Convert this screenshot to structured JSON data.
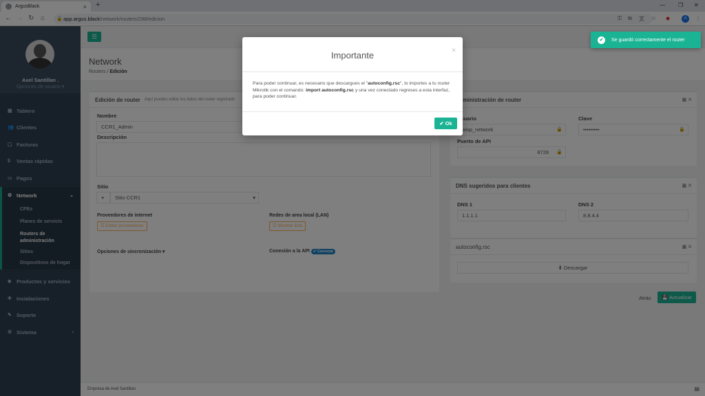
{
  "browser": {
    "tab_title": "ArgusBlack",
    "tab_close": "×",
    "new_tab": "+",
    "url_host": "app.argus.black",
    "url_path": "/network/routers/298/edicion",
    "profile_initial": "A"
  },
  "sidebar": {
    "user_name": "Axel Santillan .",
    "user_options": "Opciones de usuario ▾",
    "items": [
      {
        "label": "Tablero",
        "icon": "dashboard-icon"
      },
      {
        "label": "Clientes",
        "icon": "users-icon"
      },
      {
        "label": "Facturas",
        "icon": "file-icon"
      },
      {
        "label": "Ventas rápidas",
        "icon": "dollar-icon"
      },
      {
        "label": "Pagos",
        "icon": "money-icon"
      },
      {
        "label": "Network",
        "icon": "gear-icon"
      },
      {
        "label": "Productos y servicios",
        "icon": "tag-icon"
      },
      {
        "label": "Instalaciones",
        "icon": "wrench-icon"
      },
      {
        "label": "Soporte",
        "icon": "support-icon"
      },
      {
        "label": "Sistema",
        "icon": "cogs-icon"
      }
    ],
    "network_sub": [
      "CPEs",
      "Planes de servicio",
      "Routers de",
      "administración",
      "Sitios",
      "Dispositivos de hogar"
    ]
  },
  "page": {
    "title": "Network",
    "crumb_root": "Routers",
    "crumb_sep": "/",
    "crumb_current": "Edición"
  },
  "edit_panel": {
    "title": "Edición de router",
    "subtitle": "Aquí puedes editar los datos del router registrado",
    "name_label": "Nombre",
    "name_value": "CCR1_Admin",
    "desc_label": "Descripción",
    "site_label": "Sitio",
    "site_add": "+",
    "site_value": "Sitio CCR1",
    "isp_label": "Proveedores de internet",
    "isp_button": "☰ Editar proveedores",
    "lan_label": "Redes de area local (LAN)",
    "lan_button": "☰ Mostrar lista",
    "sync_label": "Opciones de sincronización ▾",
    "api_label": "Conexión a la API",
    "api_badge": "✔ Correcta"
  },
  "admin_panel": {
    "title": "Administración de router",
    "user_label": "Usuario",
    "user_value": "wisp_network",
    "key_label": "Clave",
    "key_value": "•••••••••",
    "port_label": "Puerto de API",
    "port_value": "8728"
  },
  "dns_panel": {
    "title": "DNS sugeridos para clientes",
    "dns1_label": "DNS 1",
    "dns1_value": "1.1.1.1",
    "dns2_label": "DNS 2",
    "dns2_value": "8.8.4.4"
  },
  "autoconf_panel": {
    "title": "autoconfig.rsc",
    "download": "⬇ Descargar"
  },
  "actions": {
    "back": "Atrás",
    "update": "💾 Actualizar"
  },
  "footer": "Empresa de Axel Santillan",
  "modal": {
    "title": "Importante",
    "close": "×",
    "body_1": "Para poder continuar, es necesario que descargues el \"",
    "body_file": "autoconfig.rsc",
    "body_2": "\", lo importes a tu router Mikrotik con el comando: ",
    "body_cmd": "import autoconfig.rsc",
    "body_3": " y una vez conectado regreses a esta interfaz, para poder continuar.",
    "ok": "✔ Ok"
  },
  "toast": {
    "message": "Se guardó correctamente el router",
    "icon": "✔"
  },
  "colors": {
    "accent": "#1ab394",
    "sidebar": "#2f4050",
    "warning": "#f8ac59",
    "badge": "#1c84c6"
  }
}
